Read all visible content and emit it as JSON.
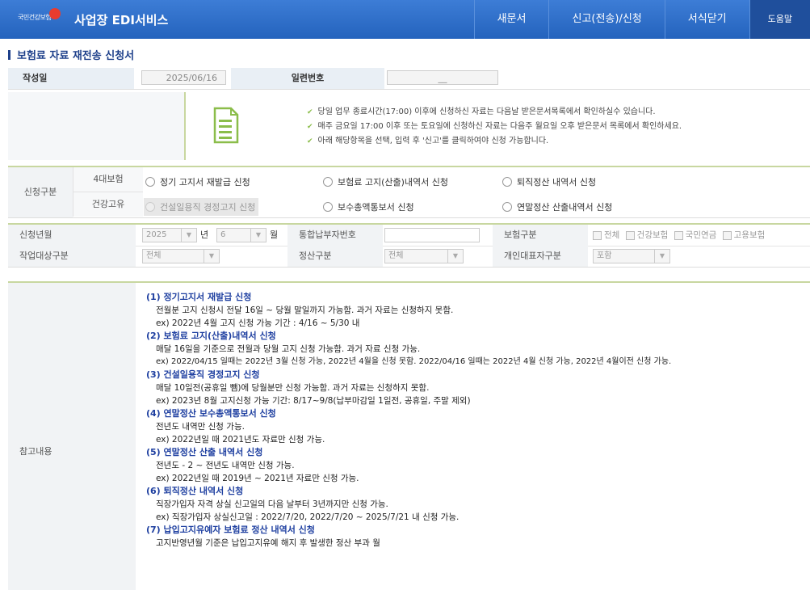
{
  "header": {
    "logo_text": "국민건강보험",
    "brand": "사업장 EDI서비스",
    "nav": [
      "새문서",
      "신고(전송)/신청",
      "서식닫기",
      "도움말"
    ]
  },
  "page_title": "보험료 자료 재전송 신청서",
  "date_row": {
    "date_label": "작성일",
    "date_value": "2025/06/16",
    "serial_label": "일련번호",
    "serial_value": "__"
  },
  "notice": [
    "당일 업무 종료시간(17:00) 이후에 신청하신 자료는 다음날 받은문서목록에서 확인하실수 있습니다.",
    "매주 금요일 17:00 이후 또는 토요일에 신청하신 자료는 다음주 월요일 오후 받은문서 목록에서 확인하세요.",
    "아래 해당항목을 선택, 입력 후 '신고'를 클릭하여야 신청 가능합니다."
  ],
  "request": {
    "label": "신청구분",
    "sub1": "4대보험",
    "sub2": "건강고유",
    "opts1": [
      "정기 고지서 재발급 신청",
      "보험료 고지(산출)내역서 신청",
      "퇴직정산 내역서 신청"
    ],
    "opts2": [
      "건설일용직 경정고지 신청",
      "보수총액통보서 신청",
      "연말정산 산출내역서 신청"
    ]
  },
  "filter": {
    "ym_label": "신청년월",
    "year": "2025",
    "year_unit": "년",
    "month": "6",
    "month_unit": "월",
    "payer_label": "통합납부자번호",
    "ins_label": "보험구분",
    "ins_opts": [
      "전체",
      "건강보험",
      "국민연금",
      "고용보험"
    ],
    "target_label": "작업대상구분",
    "target_value": "전체",
    "settle_label": "정산구분",
    "settle_value": "전체",
    "rep_label": "개인대표자구분",
    "rep_value": "포함"
  },
  "reference": {
    "label": "참고내용",
    "items": [
      {
        "h": "(1) 정기고지서 재발급 신청",
        "lines": [
          "전월분 고지 신청시 전달 16일 ~ 당월 말일까지 가능함. 과거 자료는 신청하지 못함.",
          "ex) 2022년 4월 고지 신청 가능 기간 : 4/16 ~ 5/30 내"
        ]
      },
      {
        "h": "(2) 보험료 고지(산출)내역서 신청",
        "lines": [
          "매달 16일을 기준으로 전월과 당월 고지 신청 가능함. 과거 자료 신청 가능.",
          "ex) 2022/04/15 일때는 2022년 3월 신청 가능, 2022년 4월을 신청 못함. 2022/04/16 일때는 2022년 4월 신청 가능, 2022년 4월이전 신청 가능."
        ]
      },
      {
        "h": "(3) 건설일용직 경정고지 신청",
        "lines": [
          "매달 10일전(공휴일 뺌)에 당월분만 신청 가능함. 과거 자료는 신청하지 못함.",
          "ex) 2023년 8월 고지신청 가능 기간: 8/17~9/8(납부마감일 1일전, 공휴일, 주말 제외)"
        ]
      },
      {
        "h": "(4) 연말정산 보수총액통보서 신청",
        "lines": [
          "전년도 내역만 신청 가능.",
          "ex) 2022년일 때 2021년도 자료만 신청 가능."
        ]
      },
      {
        "h": "(5) 연말정산 산출 내역서 신청",
        "lines": [
          "전년도 - 2 ~ 전년도 내역만 신청 가능.",
          "ex) 2022년일 때 2019년 ~ 2021년 자료만 신청 가능."
        ]
      },
      {
        "h": "(6) 퇴직정산 내역서 신청",
        "lines": [
          "직장가입자 자격 상실 신고일의 다음 날부터 3년까지만 신청 가능.",
          "ex) 직장가입자 상실신고일 : 2022/7/20, 2022/7/20 ~ 2025/7/21 내 신청 가능."
        ]
      },
      {
        "h": "(7) 납입고지유예자 보험료 정산 내역서 신청",
        "lines": [
          "고지반영년월 기준은 납입고지유예 해지 후 발생한 정산 부과 월"
        ]
      }
    ]
  }
}
